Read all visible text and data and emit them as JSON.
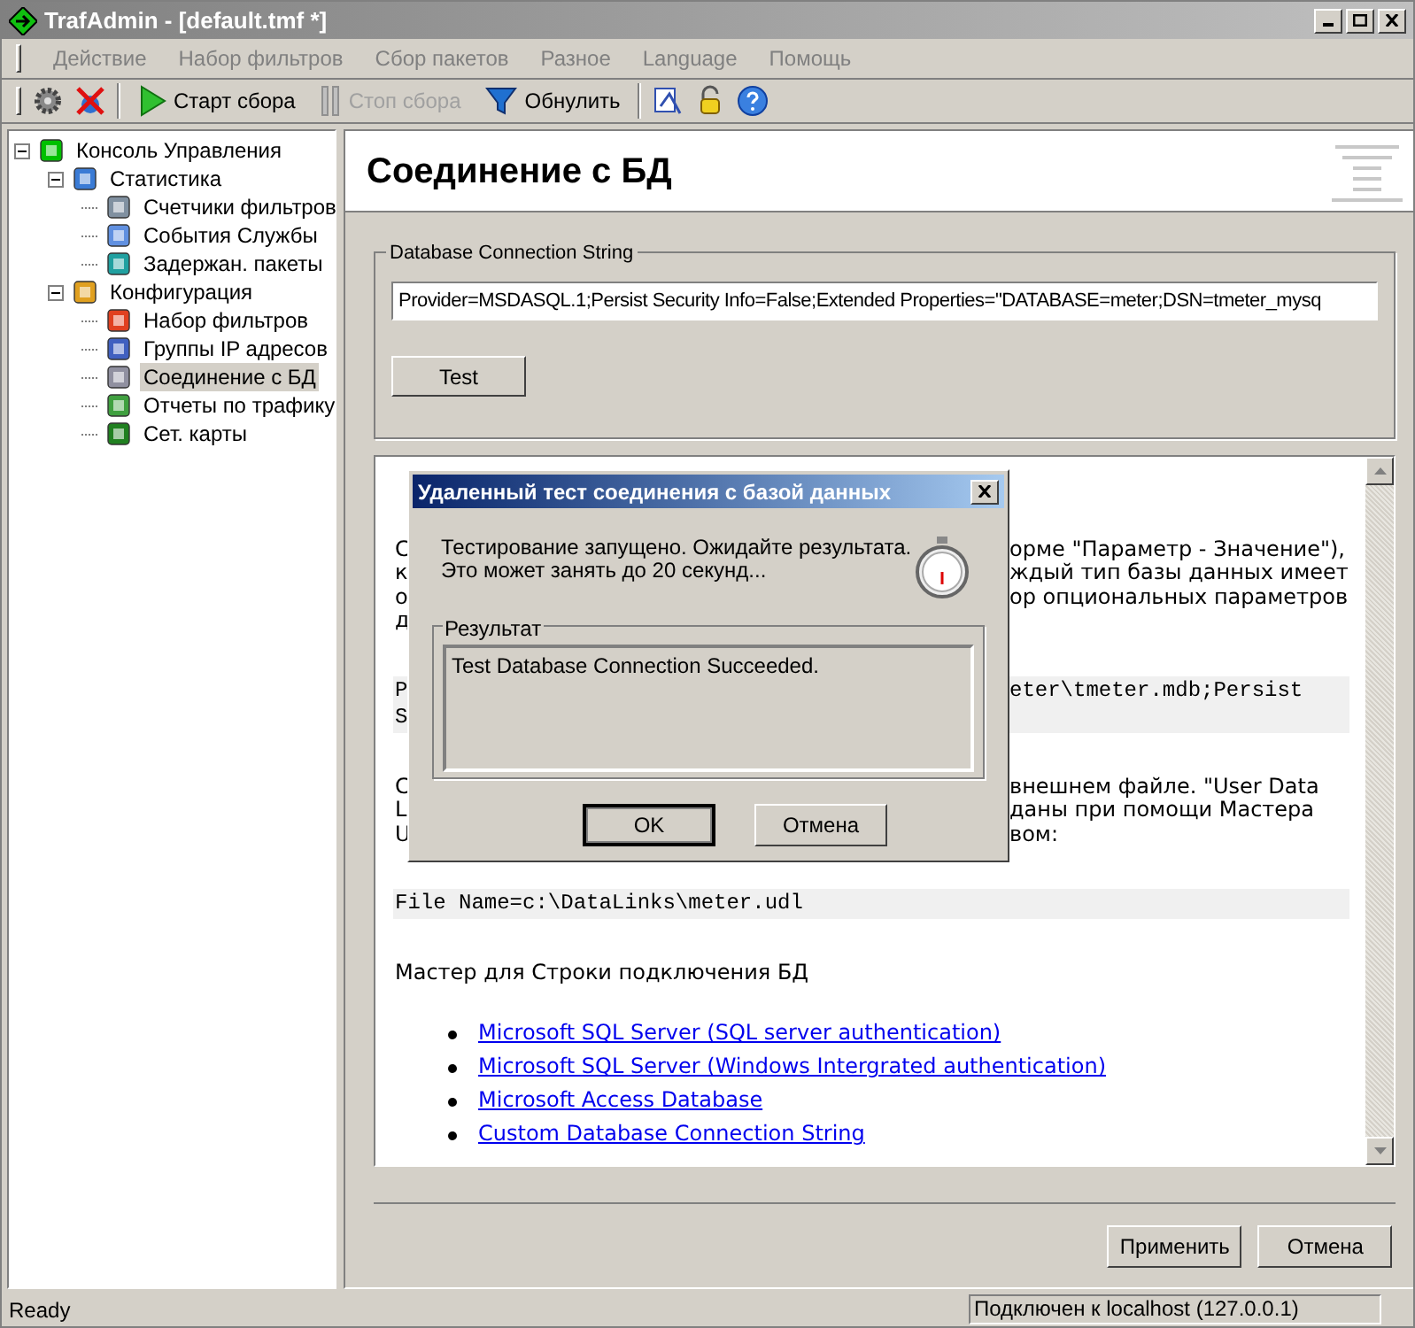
{
  "window": {
    "title": "TrafAdmin - [default.tmf *]"
  },
  "menu": [
    {
      "label": "Действие",
      "disabled": true
    },
    {
      "label": "Набор фильтров",
      "disabled": true
    },
    {
      "label": "Сбор пакетов",
      "disabled": true
    },
    {
      "label": "Разное",
      "disabled": true
    },
    {
      "label": "Language",
      "disabled": true
    },
    {
      "label": "Помощь",
      "disabled": true
    }
  ],
  "toolbar": [
    {
      "label": "Старт сбора",
      "disabled": false
    },
    {
      "label": "Стоп сбора",
      "disabled": true
    },
    {
      "label": "Обнулить",
      "disabled": false
    }
  ],
  "tree": [
    {
      "label": "Консоль Управления",
      "selected": false,
      "expanded": true,
      "children": [
        {
          "label": "Статистика",
          "selected": false,
          "expanded": true,
          "children": [
            {
              "label": "Счетчики фильтров",
              "selected": false
            },
            {
              "label": "События Службы",
              "selected": false
            },
            {
              "label": "Задержан. пакеты",
              "selected": false
            }
          ]
        },
        {
          "label": "Конфигурация",
          "selected": false,
          "expanded": true,
          "children": [
            {
              "label": "Набор фильтров",
              "selected": false
            },
            {
              "label": "Группы IP адресов",
              "selected": false
            },
            {
              "label": "Соединение с БД",
              "selected": true
            },
            {
              "label": "Отчеты по трафику",
              "selected": false
            },
            {
              "label": "Сет. карты",
              "selected": false
            }
          ]
        }
      ]
    }
  ],
  "panel": {
    "title": "Соединение с БД",
    "connection_group": {
      "label": "Database Connection String",
      "value": "Provider=MSDASQL.1;Persist Security Info=False;Extended Properties=\"DATABASE=meter;DSN=tmeter_mysq",
      "button": "Test"
    },
    "help": {
      "blocks": [
        {
          "kind": "text",
          "lines": [
            {
              "left": "С",
              "right": "орме \"Параметр - Значение\"),"
            },
            {
              "left": "к",
              "right": "ждый тип базы данных имеет"
            },
            {
              "left": "о",
              "right": "ор опциональных параметров"
            },
            {
              "left": "д"
            }
          ]
        },
        {
          "kind": "code",
          "lines": [
            {
              "left": "P",
              "right": "eter\\tmeter.mdb;Persist"
            },
            {
              "left": "S"
            }
          ]
        },
        {
          "kind": "text",
          "lines": [
            {
              "left": "С",
              "right": "внешнем файле. \"User Data"
            },
            {
              "left": "L",
              "right": "даны при помощи Мастера"
            },
            {
              "left": "U",
              "right": "вом:"
            }
          ]
        },
        {
          "kind": "code",
          "lines": [
            {
              "left": "File Name=c:\\DataLinks\\meter.udl"
            }
          ]
        },
        {
          "kind": "text",
          "lines": [
            {
              "left": "Мастер для Строки подключения БД"
            }
          ]
        }
      ],
      "links": [
        "Microsoft SQL Server (SQL server authentication)",
        "Microsoft SQL Server (Windows Intergrated authentication)",
        "Microsoft Access Database",
        "Custom Database Connection String"
      ]
    },
    "buttons": [
      "Применить",
      "Отмена"
    ]
  },
  "dialog": {
    "title": "Удаленный тест соединения с базой данных",
    "message": [
      "Тестирование запущено. Ожидайте результата.",
      "Это может занять до 20 секунд..."
    ],
    "result_label": "Результат",
    "result": "Test Database Connection Succeeded.",
    "buttons": [
      "OK",
      "Отмена"
    ]
  },
  "status_bar": {
    "left": "Ready",
    "right": "Подключен к localhost (127.0.0.1)"
  }
}
